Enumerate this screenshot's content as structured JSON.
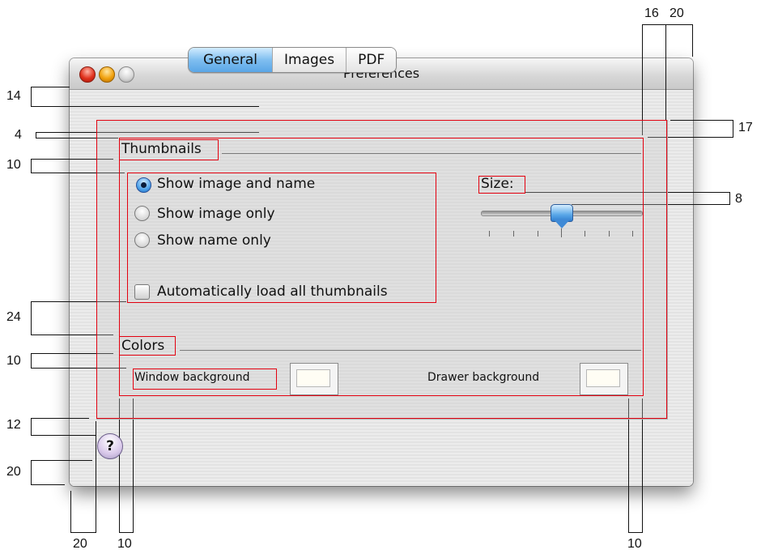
{
  "window": {
    "title": "Preferences"
  },
  "tabs": [
    {
      "label": "General",
      "selected": true
    },
    {
      "label": "Images",
      "selected": false
    },
    {
      "label": "PDF",
      "selected": false
    }
  ],
  "thumbnails": {
    "heading": "Thumbnails",
    "options": [
      "Show image and name",
      "Show image only",
      "Show name only"
    ],
    "selected_option": "Show image and name",
    "auto_load_label": "Automatically load all thumbnails",
    "auto_load_checked": false,
    "size_label": "Size:",
    "size_value_fraction": 0.5
  },
  "colors": {
    "heading": "Colors",
    "window_bg_label": "Window background",
    "drawer_bg_label": "Drawer background"
  },
  "help_button": {
    "glyph": "?"
  },
  "dimensions": {
    "top_16": "16",
    "top_20": "20",
    "right_17": "17",
    "right_8": "8",
    "left_14": "14",
    "left_4": "4",
    "left_10a": "10",
    "left_24": "24",
    "left_10b": "10",
    "left_12": "12",
    "left_20": "20",
    "bottom_20": "20",
    "bottom_10a": "10",
    "bottom_10b": "10"
  },
  "colors_palette": {
    "annotation": "#e3000f",
    "accent": "#5aa6e6"
  }
}
